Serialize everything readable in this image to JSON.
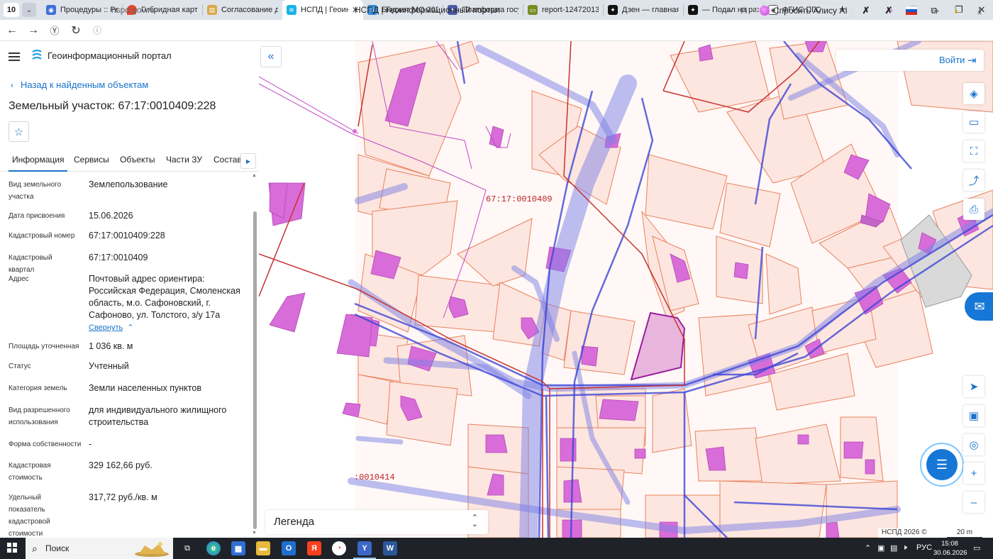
{
  "browser": {
    "tab_count": "10",
    "tabs": [
      {
        "label": "Процедуры :: Реа",
        "color": "#3f6fd8"
      },
      {
        "label": "Гибридная карта г",
        "color": "#e5452d"
      },
      {
        "label": "Согласование док",
        "color": "#d9a74a"
      },
      {
        "label": "НСПД | Геоинф",
        "color": "#1ab3e6"
      },
      {
        "label": "Бюджет МО 2025",
        "color": "#2f8de0"
      },
      {
        "label": "Платформа госуд",
        "color": "#4b5ba8"
      },
      {
        "label": "report-12472013-f",
        "color": "#7a8c22"
      },
      {
        "label": "Дзен — главная н",
        "color": "#111111"
      },
      {
        "label": "— Подал на разво",
        "color": "#111111"
      },
      {
        "label": "ФГИС ПГС",
        "color": "#333333"
      }
    ],
    "url": "nspd.gov.ru",
    "page_title": "НСПД | Геоинформационный портал",
    "alice_label": "Спросить Алису AI"
  },
  "panel": {
    "portal_name": "Геоинформационный портал",
    "back_label": "Назад к найденным объектам",
    "object_title": "Земельный участок: 67:17:0010409:228",
    "tabs": [
      "Информация",
      "Сервисы",
      "Объекты",
      "Части ЗУ",
      "Состав"
    ],
    "fields": [
      {
        "key": "Вид земельного участка",
        "value": "Землепользование"
      },
      {
        "key": "Дата присвоения",
        "value": "15.06.2026"
      },
      {
        "key": "Кадастровый номер",
        "value": "67:17:0010409:228"
      },
      {
        "key": "Кадастровый квартал",
        "value": "67:17:0010409"
      },
      {
        "key": "Адрес",
        "value": "Почтовый адрес ориентира: Российская Федерация, Смоленская область, м.о. Сафоновский, г. Сафоново, ул. Толстого, з/у 17а"
      },
      {
        "key": "Площадь уточненная",
        "value": "1 036 кв. м"
      },
      {
        "key": "Статус",
        "value": "Учтенный"
      },
      {
        "key": "Категория земель",
        "value": "Земли населенных пунктов"
      },
      {
        "key": "Вид разрешенного использования",
        "value": "для индивидуального жилищного строительства"
      },
      {
        "key": "Форма собственности",
        "value": "-"
      },
      {
        "key": "Кадастровая стоимость",
        "value": "329 162,66 руб."
      },
      {
        "key": "Удельный показатель кадастровой стоимости",
        "value": "317,72 руб./кв. м"
      }
    ],
    "collapse_label": "Свернуть"
  },
  "map": {
    "quarter_label": "67:17:0010409",
    "quarter_label_2": ":0010414",
    "legend_label": "Легенда",
    "login_label": "Войти",
    "copyright": "НСПД 2026 ©",
    "scale": "20 m"
  },
  "taskbar": {
    "search_label": "Поиск",
    "lang": "РУС",
    "time": "15:08",
    "date": "30.06.2026"
  }
}
